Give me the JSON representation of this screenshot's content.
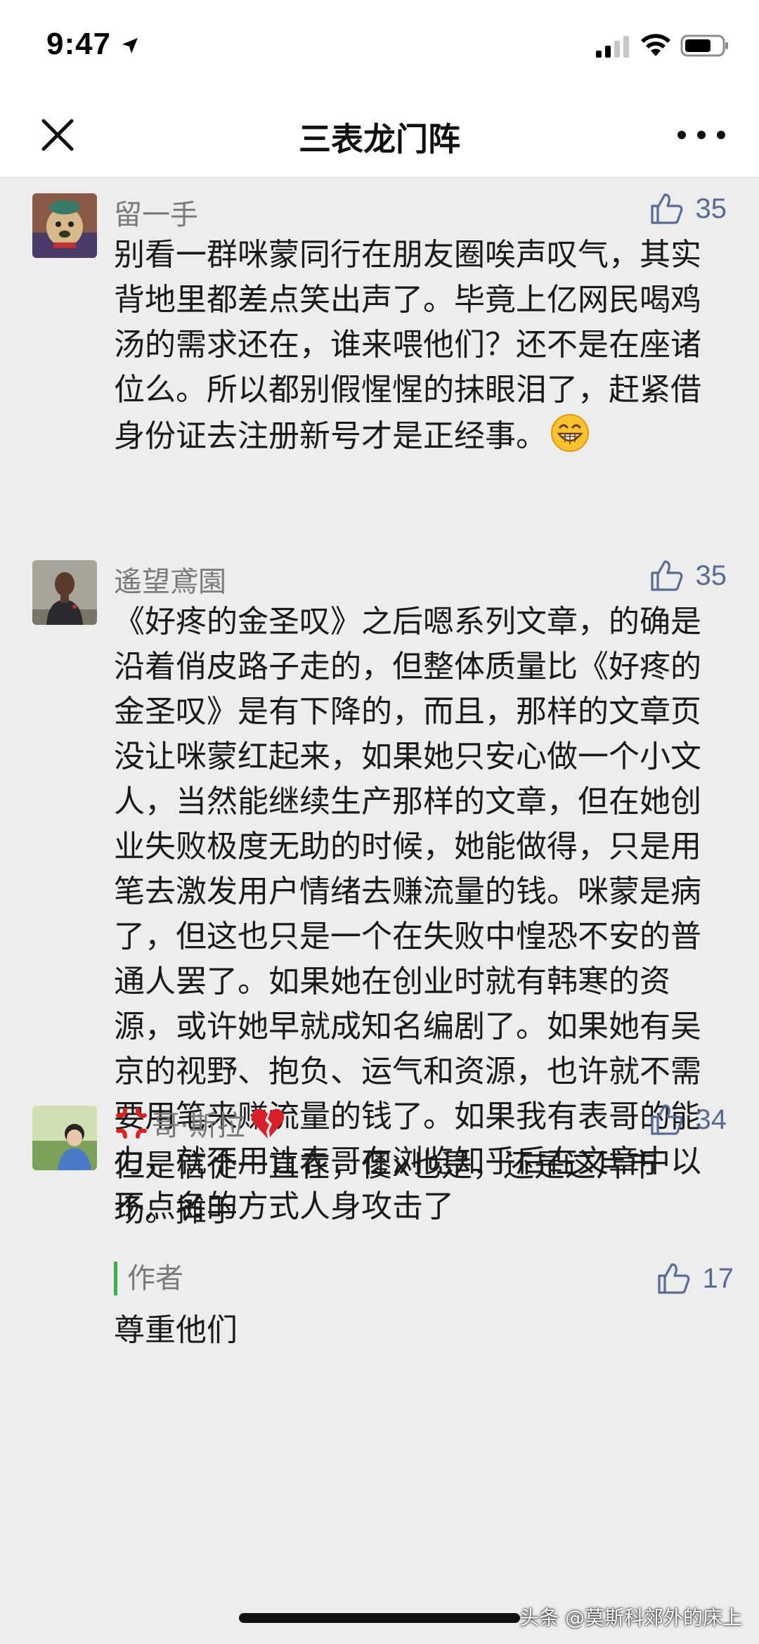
{
  "status_bar": {
    "time": "9:47"
  },
  "nav": {
    "title": "三表龙门阵",
    "close_icon": "close-icon",
    "more_icon": "more-dots-icon"
  },
  "colors": {
    "accent_link": "#576b95",
    "author_bar": "#3bb04a",
    "background": "#ededed"
  },
  "comments": [
    {
      "name": "留一手",
      "likes": "35",
      "text": "别看一群咪蒙同行在朋友圈唉声叹气，其实背地里都差点笑出声了。毕竟上亿网民喝鸡汤的需求还在，谁来喂他们？还不是在座诸位么。所以都别假惺惺的抹眼泪了，赶紧借身份证去注册新号才是正经事。",
      "emoji": "grin-emoji"
    },
    {
      "name": "遙望鳶園",
      "likes": "35",
      "text": "《好疼的金圣叹》之后嗯系列文章，的确是沿着俏皮路子走的，但整体质量比《好疼的金圣叹》是有下降的，而且，那样的文章页没让咪蒙红起来，如果她只安心做一个小文人，当然能继续生产那样的文章，但在她创业失败极度无助的时候，她能做得，只是用笔去激发用户情绪去赚流量的钱。咪蒙是病了，但这也只是一个在失败中惶恐不安的普通人罢了。如果她在创业时就有韩寒的资源，或许她早就成知名编剧了。如果她有吴京的视野、抱负、运气和资源，也许就不需要用笔来赚流量的钱了。如果我有表哥的能力，就不用让表哥在浏览知乎后在文章中以不点名的方式人身攻击了"
    },
    {
      "name": "哥·斯拉",
      "name_prefix_emoji": "anger-emoji",
      "name_suffix_emoji": "broken-heart-emoji",
      "likes": "34",
      "text": "但是信徒一直在，傻x也是，还是这片市场。摊手",
      "reply": {
        "tag": "作者",
        "likes": "17",
        "text": "尊重他们"
      }
    }
  ],
  "watermark": "头条 @莫斯科郊外的床上"
}
